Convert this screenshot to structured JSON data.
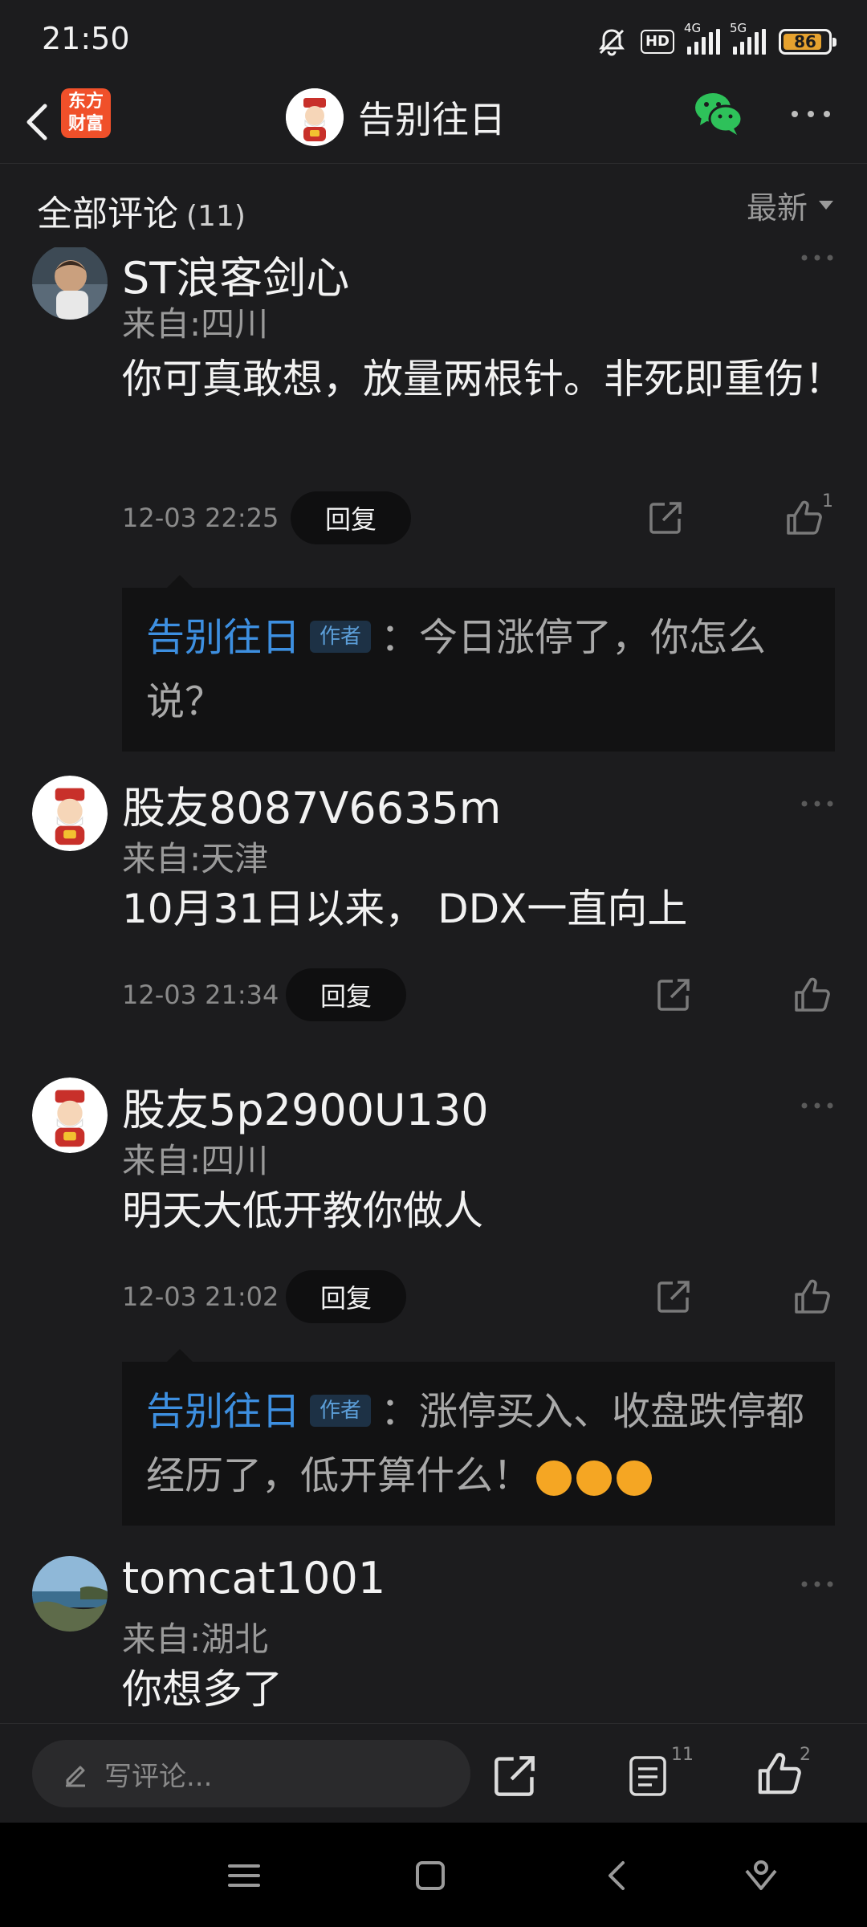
{
  "status_bar": {
    "time": "21:50",
    "network_1": "4G",
    "network_2": "5G",
    "hd_label": "HD",
    "battery_level": 86,
    "battery_text": "86"
  },
  "header": {
    "logo_text_line1": "东方",
    "logo_text_line2": "财富",
    "title": "告别往日"
  },
  "comments_header": {
    "title": "全部评论",
    "count": "(11)",
    "sort_label": "最新"
  },
  "comments": [
    {
      "name": "ST浪客剑心",
      "location": "来自:四川",
      "body": "你可真敢想，放量两根针。非死即重伤！",
      "time": "12-03 22:25",
      "reply_label": "回复",
      "like_count": "1",
      "author_reply": {
        "author": "告别往日",
        "badge": "作者",
        "text": "：今日涨停了，你怎么说？"
      }
    },
    {
      "name": "股友8087V6635m",
      "location": "来自:天津",
      "body": "10月31日以来， DDX一直向上",
      "time": "12-03 21:34",
      "reply_label": "回复",
      "like_count": ""
    },
    {
      "name": "股友5p2900U130",
      "location": "来自:四川",
      "body": "明天大低开教你做人",
      "time": "12-03 21:02",
      "reply_label": "回复",
      "like_count": "",
      "author_reply": {
        "author": "告别往日",
        "badge": "作者",
        "text": "：涨停买入、收盘跌停都经历了，低开算什么！"
      }
    },
    {
      "name": "tomcat1001",
      "location": "来自:湖北",
      "body": "你想多了"
    }
  ],
  "bottom_bar": {
    "placeholder": "写评论...",
    "comment_count": "11",
    "like_count": "2"
  },
  "icons": {
    "back": "chevron-left-icon",
    "wechat": "wechat-icon",
    "more": "more-horizontal-icon",
    "share": "share-icon",
    "like": "thumbs-up-icon",
    "list": "comment-list-icon",
    "pencil": "pencil-icon"
  },
  "colors": {
    "background": "#1c1c1e",
    "author_link": "#3d8fe0",
    "brand_orange": "#f0502a",
    "wechat_green": "#2ec15a",
    "battery": "#e6a22f"
  }
}
